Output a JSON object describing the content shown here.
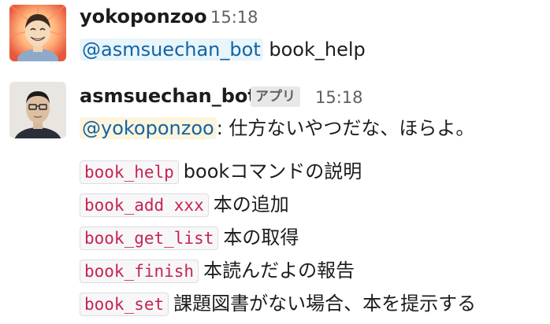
{
  "messages": [
    {
      "author": "yokoponzoo",
      "time": "15:18",
      "mention": "@asmsuechan_bot",
      "text": " book_help"
    },
    {
      "author": "asmsuechan_bot",
      "badge": "アプリ",
      "time": "15:18",
      "mention": "@yokoponzoo",
      "text": ": 仕方ないやつだな、ほらよ。",
      "commands": [
        {
          "cmd": "book_help",
          "desc": "bookコマンドの説明"
        },
        {
          "cmd": "book_add xxx",
          "desc": "本の追加"
        },
        {
          "cmd": "book_get_list",
          "desc": "本の取得"
        },
        {
          "cmd": "book_finish",
          "desc": "本読んだよの報告"
        },
        {
          "cmd": "book_set",
          "desc": "課題図書がない場合、本を提示する"
        }
      ]
    }
  ],
  "icons": {
    "avatar_1": "cartoon-avatar-icon",
    "avatar_2": "photo-avatar-icon"
  },
  "colors": {
    "mention": "#1264a3",
    "code_text": "#c7254e"
  }
}
